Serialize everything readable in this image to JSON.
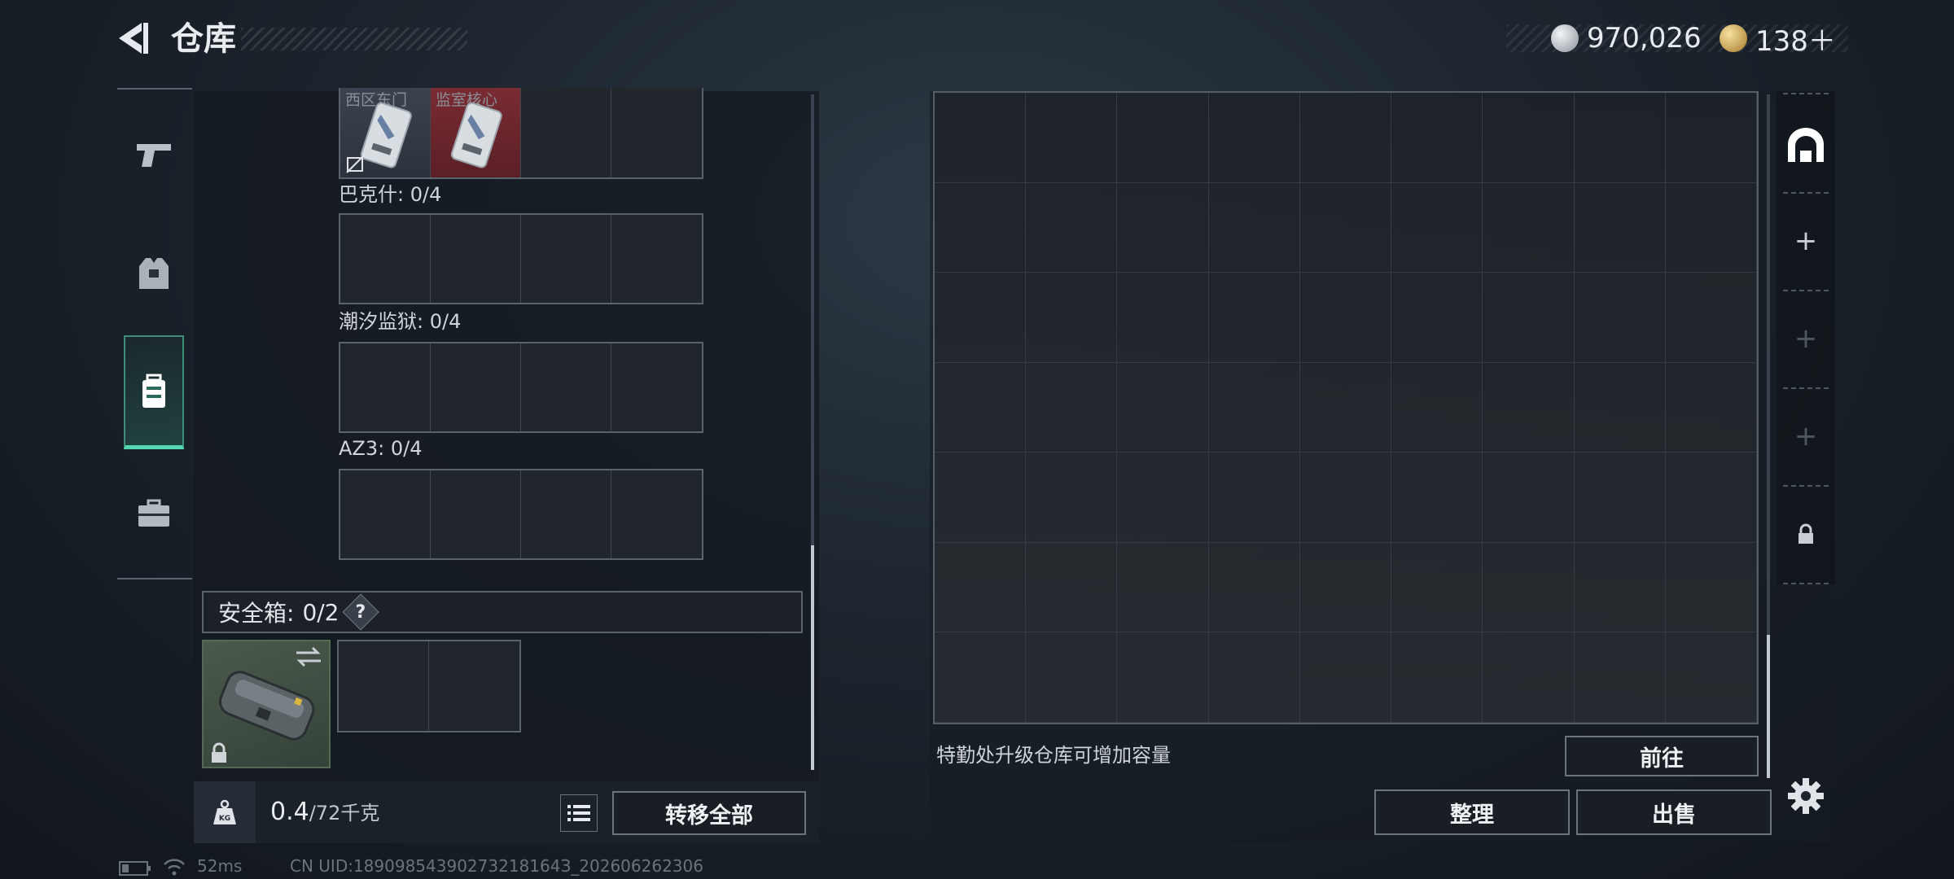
{
  "header": {
    "title": "仓库",
    "currency_silver": "970,026",
    "currency_gold": "138＋"
  },
  "left_nav": {
    "items": [
      {
        "name": "weapons",
        "icon": "pistol-icon"
      },
      {
        "name": "armor",
        "icon": "vest-icon"
      },
      {
        "name": "backpack",
        "icon": "backpack-icon",
        "active": true
      },
      {
        "name": "toolbox",
        "icon": "toolbox-icon"
      }
    ]
  },
  "key_sections": {
    "top_cards": [
      "西区东门",
      "监室核心"
    ],
    "bakeshi": "巴克什: 0/4",
    "chaoxi": "潮汐监狱: 0/4",
    "az3": "AZ3: 0/4"
  },
  "safe_box": {
    "label": "安全箱:",
    "count": "0/2",
    "help": "?"
  },
  "bottom": {
    "weight_value": "0.4",
    "weight_max": "/72千克",
    "transfer_all": "转移全部"
  },
  "storage": {
    "hint": "特勤处升级仓库可增加容量",
    "goto": "前往",
    "sort": "整理",
    "sell": "出售"
  },
  "right_nav": {
    "plus": "+"
  },
  "status_bar": {
    "ping": "52ms",
    "uid": "CN UID:18909854390273218164З_202606262306"
  },
  "colors": {
    "accent_green": "#55d6b0",
    "card_red": "#8a2a32"
  }
}
